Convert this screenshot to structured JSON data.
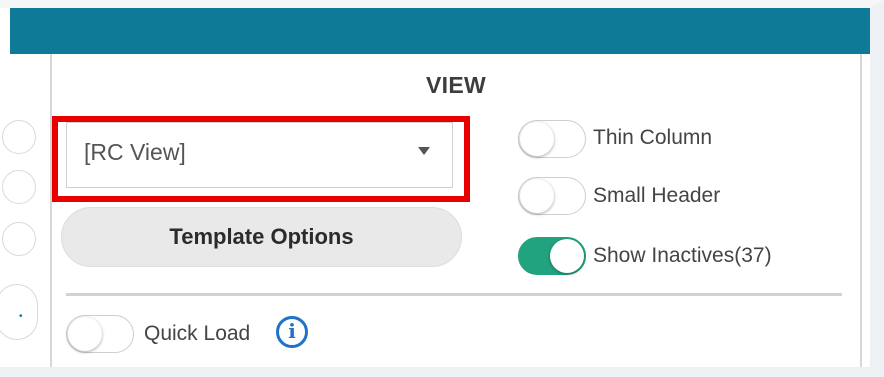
{
  "panel": {
    "title": "VIEW"
  },
  "view_select": {
    "selected": "[RC View]"
  },
  "template_options": {
    "label": "Template Options"
  },
  "toggles": {
    "thin_column": {
      "label": "Thin Column",
      "state": "off"
    },
    "small_header": {
      "label": "Small Header",
      "state": "off"
    },
    "show_inactives": {
      "label": "Show Inactives(37)",
      "state": "on"
    },
    "quick_load": {
      "label": "Quick Load",
      "state": "off"
    }
  },
  "colors": {
    "header_bar": "#0e7a98",
    "highlight": "#e60000",
    "toggle_on": "#21a37f",
    "info_icon": "#1f72c7"
  },
  "icons": {
    "dropdown": "caret-down-icon",
    "info": "info-icon"
  }
}
